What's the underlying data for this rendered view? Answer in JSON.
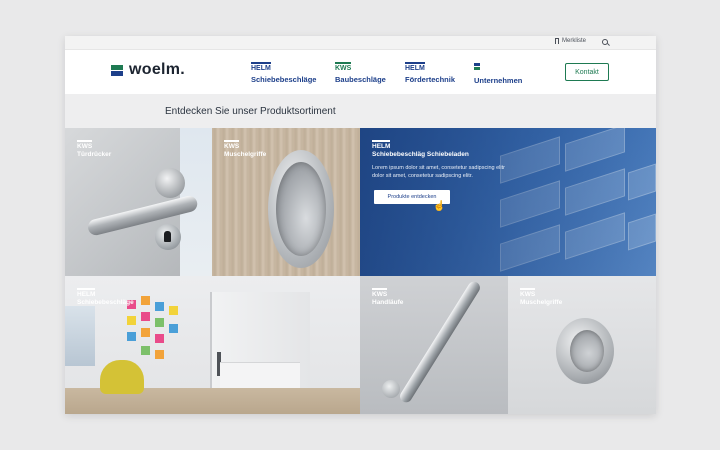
{
  "topbar": {
    "merkliste_label": "Merkliste",
    "bookmark_icon": "bookmark-icon",
    "search_icon": "search-icon"
  },
  "header": {
    "logo_text": "woelm.",
    "nav": [
      {
        "brand": "HELM",
        "label": "Schiebebeschläge",
        "color": "#1d3f8a"
      },
      {
        "brand": "KWS",
        "label": "Baubeschläge",
        "color": "#1e7a52"
      },
      {
        "brand": "HELM",
        "label": "Fördertechnik",
        "color": "#1d3f8a"
      },
      {
        "brand": "",
        "label": "Unternehmen",
        "color": "#1d3f8a"
      }
    ],
    "kontakt_label": "Kontakt"
  },
  "heading": "Entdecken Sie unser Produktsortiment",
  "tiles": [
    {
      "brand": "KWS",
      "label": "Türdrücker"
    },
    {
      "brand": "KWS",
      "label": "Muschelgriffe"
    },
    {
      "brand": "HELM",
      "label": "Schiebebeschläg Schiebeladen",
      "desc": "Lorem ipsum dolor sit amet, consetetur sadipscing elitr dolor sit amet, consetetur sadipscing elitr.",
      "button": "Produkte entdecken"
    },
    {
      "brand": "HELM",
      "label": "Schiebebeschläge"
    },
    {
      "brand": "KWS",
      "label": "Handläufe"
    },
    {
      "brand": "KWS",
      "label": "Muschelgriffe"
    }
  ],
  "colors": {
    "brand_blue": "#1d3f8a",
    "brand_green": "#1e7a52"
  }
}
